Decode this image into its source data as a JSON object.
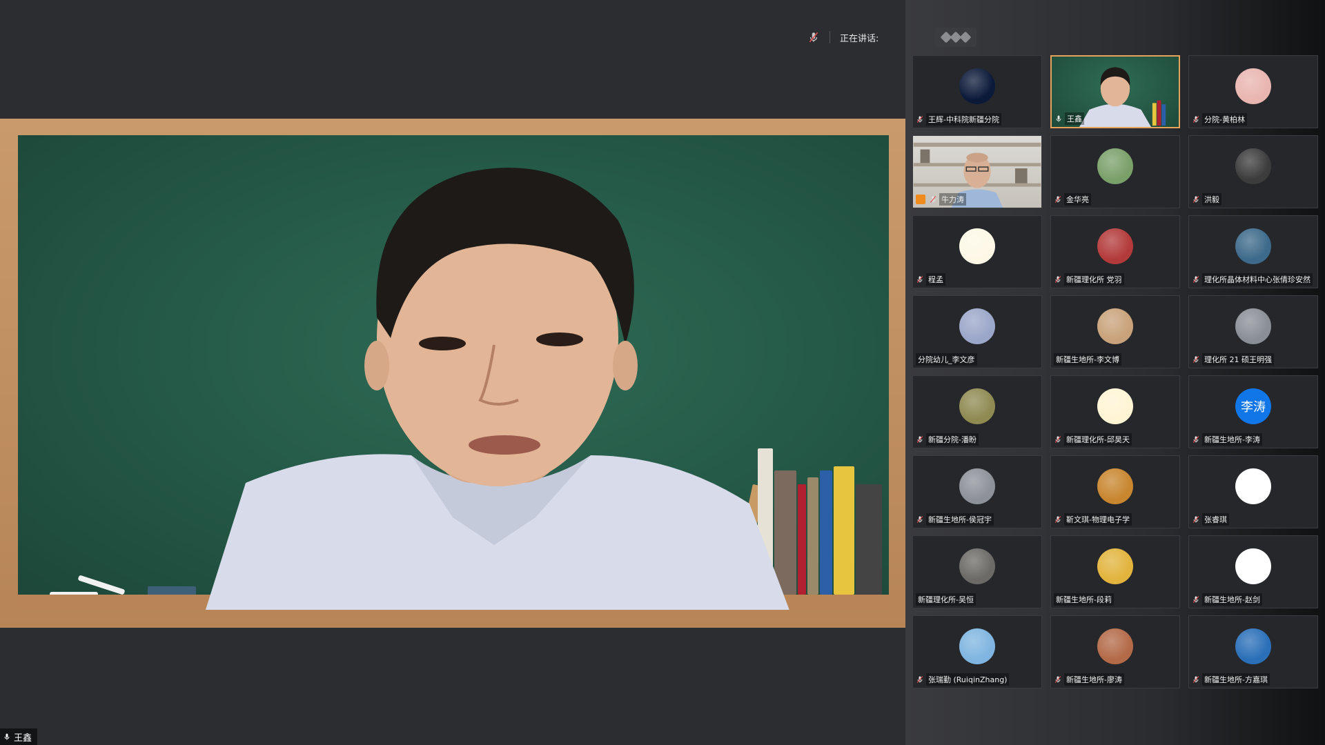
{
  "speaking": {
    "label": "正在讲话:"
  },
  "main_video": {
    "speaker_name": "王鑫"
  },
  "participants": [
    {
      "name": "王辉-中科院新疆分院",
      "avatar": "moon-avatar",
      "color": "#0c1a3a",
      "muted": true
    },
    {
      "name": "王鑫",
      "avatar": "video",
      "color": "#2a5e4c",
      "muted": false,
      "active": true
    },
    {
      "name": "分院-黄柏林",
      "avatar": "cartoon-avatar",
      "color": "#e9b5b0",
      "muted": true
    },
    {
      "name": "牛力涛",
      "avatar": "video",
      "color": "#d8d6d1",
      "muted": true,
      "host": true
    },
    {
      "name": "金华亮",
      "avatar": "tree-avatar",
      "color": "#7aa06a",
      "muted": true
    },
    {
      "name": "洪毅",
      "avatar": "photo-avatar",
      "color": "#3c3c3c",
      "muted": true
    },
    {
      "name": "程孟",
      "avatar": "pikachu-avatar",
      "color": "#fdf8e6",
      "muted": true
    },
    {
      "name": "新疆理化所 党羽",
      "avatar": "anime-avatar",
      "color": "#b33a3a",
      "muted": true
    },
    {
      "name": "理化所晶体材料中心张倩珍安然",
      "avatar": "landscape-avatar",
      "color": "#3d6a8a",
      "muted": true
    },
    {
      "name": "分院幼儿_李文彦",
      "avatar": "girl-avatar",
      "color": "#9ba7c9",
      "muted": false
    },
    {
      "name": "新疆生地所-李文博",
      "avatar": "cat-avatar",
      "color": "#c8a27a",
      "muted": false
    },
    {
      "name": "理化所 21 硕王明强",
      "avatar": "anime-boy-avatar",
      "color": "#8a8f96",
      "muted": true
    },
    {
      "name": "新疆分院-潘盼",
      "avatar": "road-avatar",
      "color": "#8f8a52",
      "muted": true
    },
    {
      "name": "新疆理化所-邱昊天",
      "avatar": "pikachu-hat-avatar",
      "color": "#fff4d4",
      "muted": true
    },
    {
      "name": "新疆生地所-李涛",
      "avatar": "text-avatar",
      "avatar_text": "李涛",
      "color": "#1177e8",
      "muted": true
    },
    {
      "name": "新疆生地所-侯冠宇",
      "avatar": "photo-avatar",
      "color": "#8d9198",
      "muted": true
    },
    {
      "name": "靳文琪-物理电子学",
      "avatar": "dog-avatar",
      "color": "#c8862f",
      "muted": true
    },
    {
      "name": "张睿琪",
      "avatar": "shoe-avatar",
      "color": "#ffffff",
      "muted": true
    },
    {
      "name": "新疆理化所-吴恒",
      "avatar": "photo-avatar",
      "color": "#6c6a66",
      "muted": false
    },
    {
      "name": "新疆生地所-段莉",
      "avatar": "girl-photo-avatar",
      "color": "#e2b43d",
      "muted": false
    },
    {
      "name": "新疆生地所-赵剑",
      "avatar": "frog-avatar",
      "color": "#ffffff",
      "muted": true
    },
    {
      "name": "张瑞勤 (RuiqinZhang)",
      "avatar": "lupin-avatar",
      "color": "#7fb5e0",
      "muted": true
    },
    {
      "name": "新疆生地所-廖涛",
      "avatar": "group-avatar",
      "color": "#b36a48",
      "muted": true
    },
    {
      "name": "新疆生地所-方嘉琪",
      "avatar": "cartoon-girl-avatar",
      "color": "#2a6fb8",
      "muted": true
    }
  ]
}
